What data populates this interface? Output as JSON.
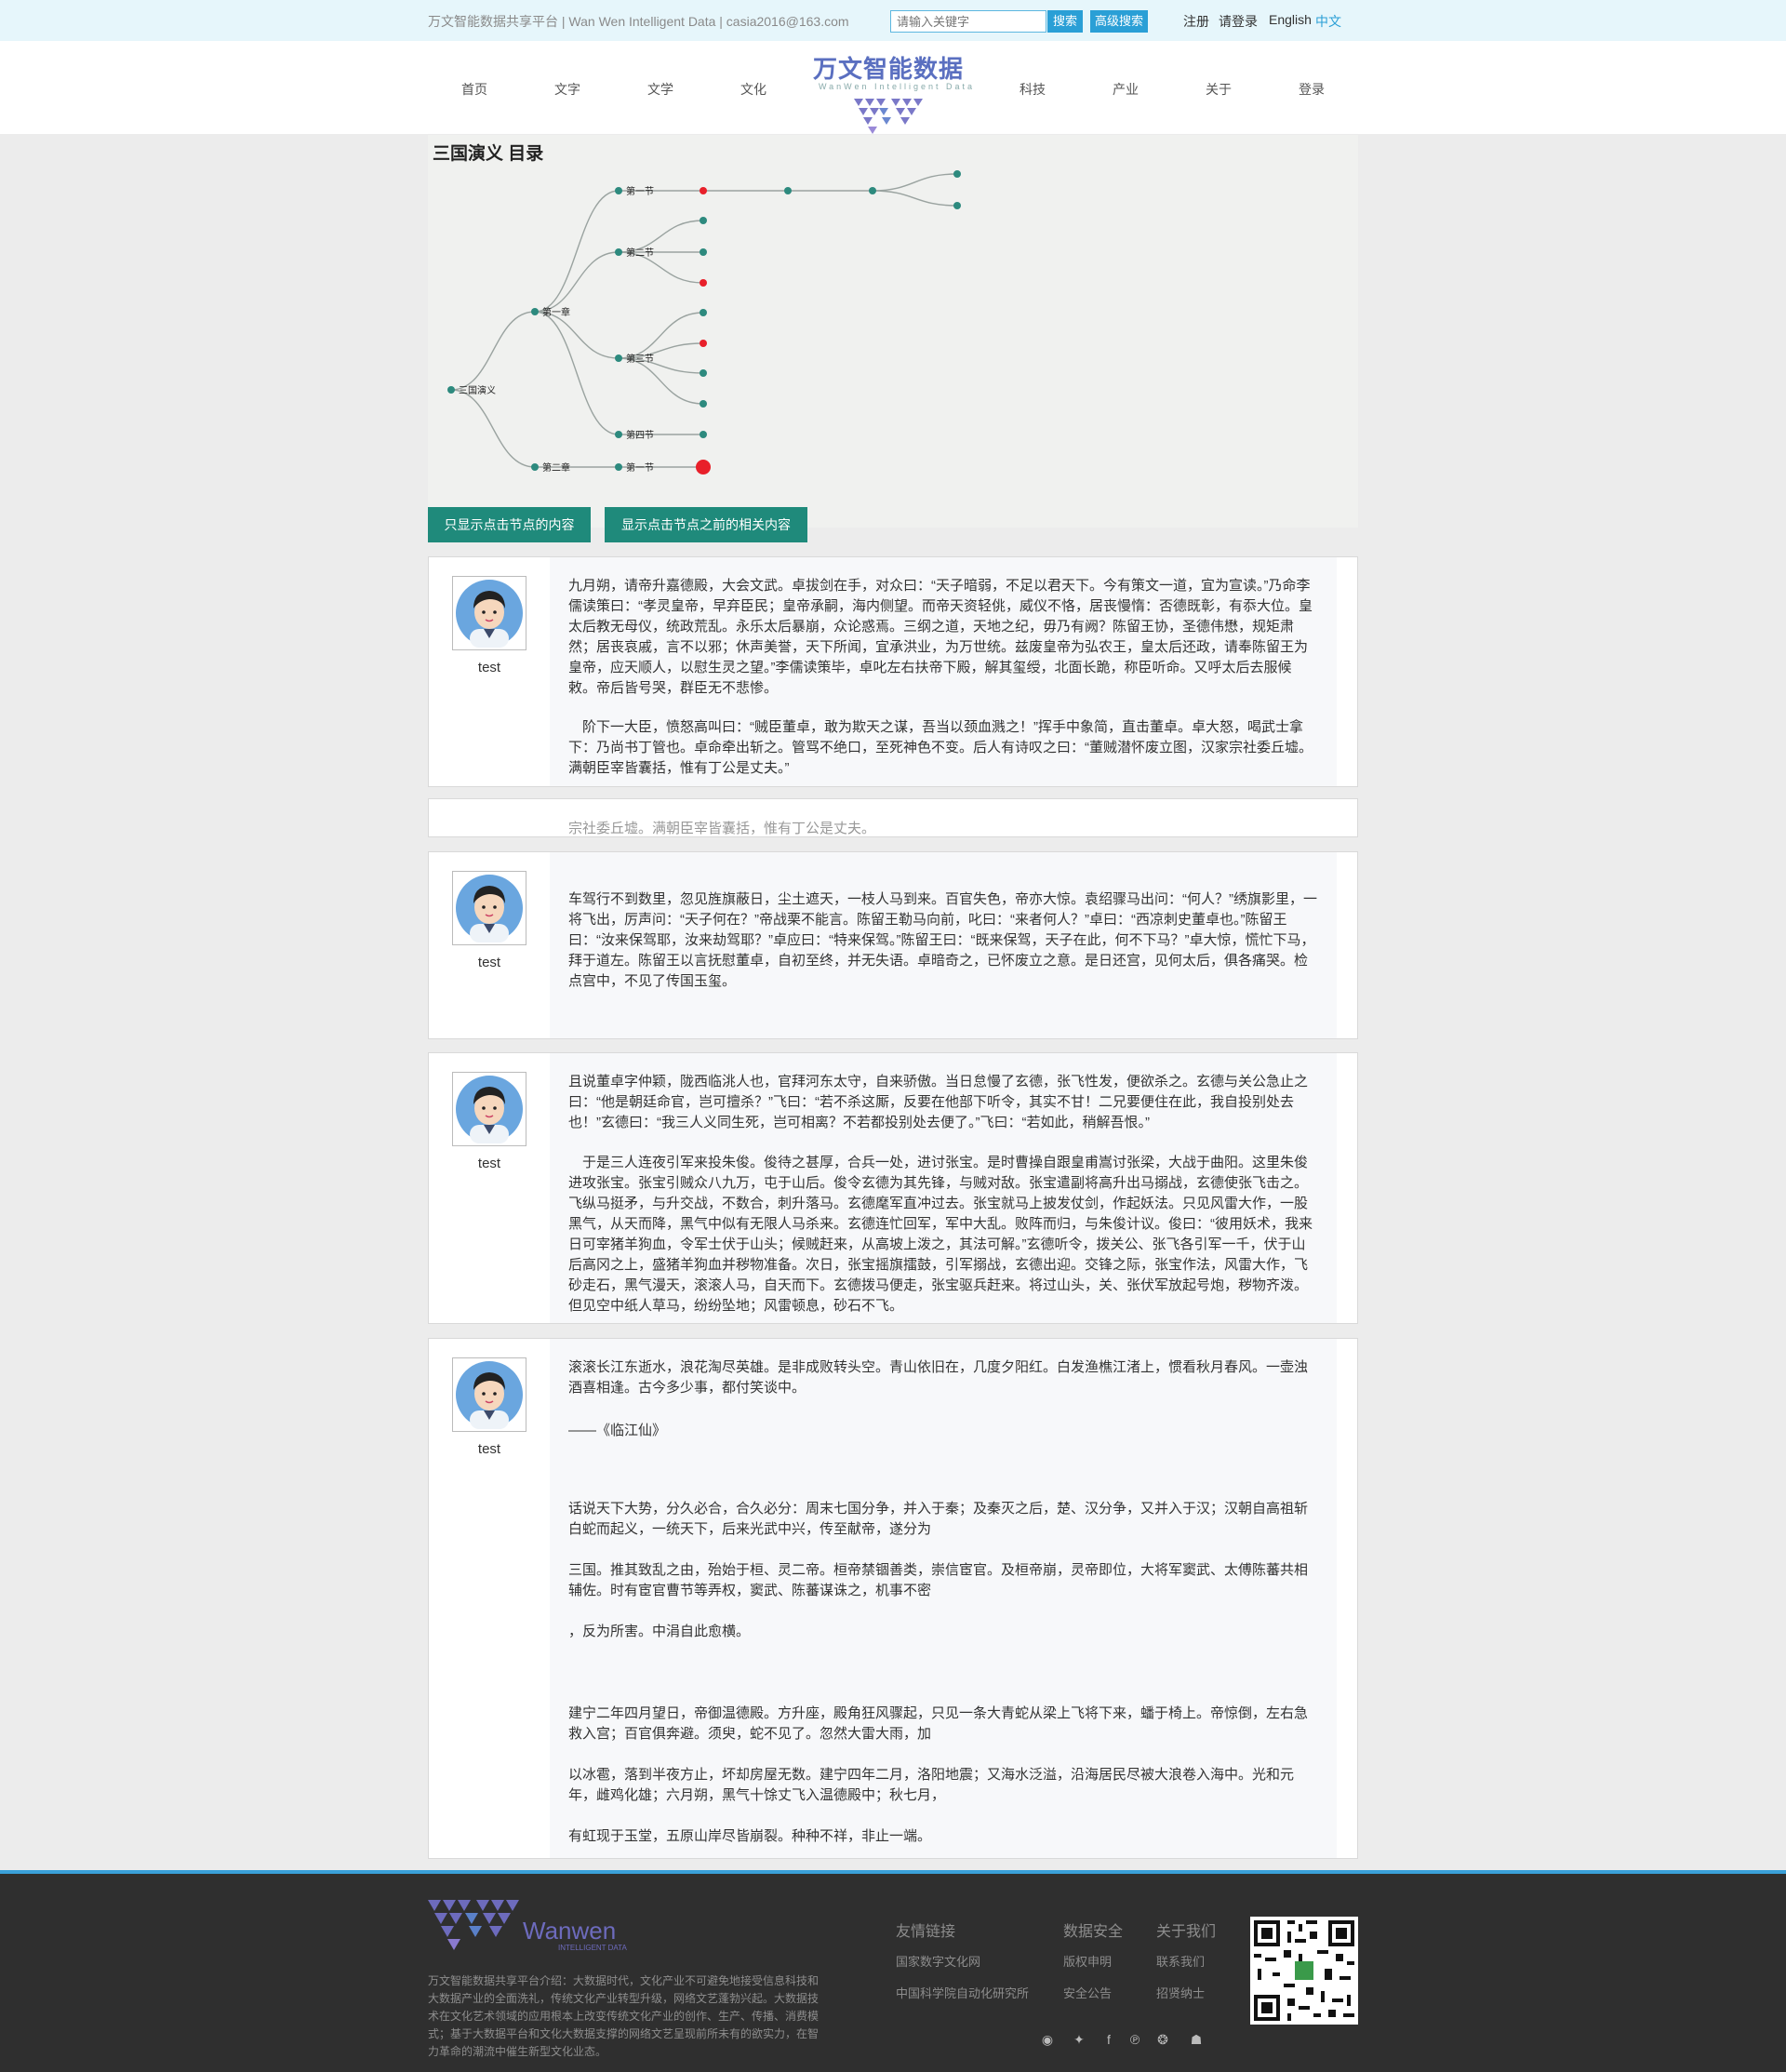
{
  "topbar": {
    "site_info": "万文智能数据共享平台 | Wan Wen Intelligent Data | casia2016@163.com",
    "search_placeholder": "请输入关键字",
    "search_label": "搜索",
    "advanced_label": "高级搜索",
    "register": "注册",
    "login": "请登录",
    "english": "English",
    "chinese": "中文"
  },
  "logo": {
    "title": "万文智能数据",
    "subtitle": "WanWen Intelligent Data"
  },
  "nav": [
    "首页",
    "文字",
    "文学",
    "文化",
    "科技",
    "产业",
    "关于",
    "登录"
  ],
  "page_title": "三国演义 目录",
  "tree": {
    "root": "三国演义",
    "chapter1": "第一章",
    "chapter2": "第二章",
    "s1": "第一节",
    "s2": "第二节",
    "s3": "第三节",
    "s4": "第四节",
    "c2s1": "第一节"
  },
  "buttons": {
    "only_clicked": "只显示点击节点的内容",
    "before_clicked": "显示点击节点之前的相关内容"
  },
  "posts": [
    {
      "author": "test",
      "paragraphs": [
        "九月朔，请帝升嘉德殿，大会文武。卓拔剑在手，对众曰：“天子暗弱，不足以君天下。今有策文一道，宜为宣读。”乃命李儒读策曰：“孝灵皇帝，早弃臣民；皇帝承嗣，海内侧望。而帝天资轻佻，威仪不恪，居丧慢惰：否德既彰，有忝大位。皇太后教无母仪，统政荒乱。永乐太后暴崩，众论惑焉。三纲之道，天地之纪，毋乃有阙？陈留王协，圣德伟懋，规矩肃然；居丧哀戚，言不以邪；休声美誉，天下所闻，宜承洪业，为万世统。兹废皇帝为弘农王，皇太后还政，请奉陈留王为皇帝，应天顺人，以慰生灵之望。”李儒读策毕，卓叱左右扶帝下殿，解其玺绶，北面长跪，称臣听命。又呼太后去服候敕。帝后皆号哭，群臣无不悲惨。",
        "　阶下一大臣，愤怒高叫曰：“贼臣董卓，敢为欺天之谋，吾当以颈血溅之！”挥手中象简，直击董卓。卓大怒，喝武士拿下：乃尚书丁管也。卓命牵出斩之。管骂不绝口，至死神色不变。后人有诗叹之曰：“董贼潜怀废立图，汉家宗社委丘墟。满朝臣宰皆囊括，惟有丁公是丈夫。”"
      ]
    },
    {
      "author": "test",
      "paragraphs": [
        "车驾行不到数里，忽见旌旗蔽日，尘土遮天，一枝人马到来。百官失色，帝亦大惊。袁绍骤马出问：“何人？”绣旗影里，一将飞出，厉声问：“天子何在？”帝战栗不能言。陈留王勒马向前，叱曰：“来者何人？”卓曰：“西凉刺史董卓也。”陈留王曰：“汝来保驾耶，汝来劫驾耶？”卓应曰：“特来保驾。”陈留王曰：“既来保驾，天子在此，何不下马？”卓大惊，慌忙下马，拜于道左。陈留王以言抚慰董卓，自初至终，并无失语。卓暗奇之，已怀废立之意。是日还宫，见何太后，俱各痛哭。检点宫中，不见了传国玉玺。"
      ]
    },
    {
      "author": "test",
      "paragraphs": [
        "且说董卓字仲颖，陇西临洮人也，官拜河东太守，自来骄傲。当日怠慢了玄德，张飞性发，便欲杀之。玄德与关公急止之曰：“他是朝廷命官，岂可擅杀？”飞曰：“若不杀这厮，反要在他部下听令，其实不甘！二兄要便住在此，我自投别处去也！”玄德曰：“我三人义同生死，岂可相离？不若都投别处去便了。”飞曰：“若如此，稍解吾恨。”",
        "　于是三人连夜引军来投朱俊。俊待之甚厚，合兵一处，进讨张宝。是时曹操自跟皇甫嵩讨张梁，大战于曲阳。这里朱俊进攻张宝。张宝引贼众八九万，屯于山后。俊令玄德为其先锋，与贼对敌。张宝遣副将高升出马搦战，玄德使张飞击之。飞纵马挺矛，与升交战，不数合，刺升落马。玄德麾军直冲过去。张宝就马上披发仗剑，作起妖法。只见风雷大作，一股黑气，从天而降，黑气中似有无限人马杀来。玄德连忙回军，军中大乱。败阵而归，与朱俊计议。俊曰：“彼用妖术，我来日可宰猪羊狗血，令军士伏于山头；候贼赶来，从高坡上泼之，其法可解。”玄德听令，拨关公、张飞各引军一千，伏于山后高冈之上，盛猪羊狗血并秽物准备。次日，张宝摇旗擂鼓，引军搦战，玄德出迎。交锋之际，张宝作法，风雷大作，飞砂走石，黑气漫天，滚滚人马，自天而下。玄德拨马便走，张宝驱兵赶来。将过山头，关、张伏军放起号炮，秽物齐泼。但见空中纸人草马，纷纷坠地；风雷顿息，砂石不飞。"
      ]
    },
    {
      "author": "test",
      "paragraphs": [
        "滚滚长江东逝水，浪花淘尽英雄。是非成败转头空。青山依旧在，几度夕阳红。白发渔樵江渚上，惯看秋月春风。一壶浊酒喜相逢。古今多少事，都付笑谈中。",
        "——《临江仙》",
        "话说天下大势，分久必合，合久必分：周末七国分争，并入于秦；及秦灭之后，楚、汉分争，又并入于汉；汉朝自高祖斩白蛇而起义，一统天下，后来光武中兴，传至献帝，遂分为",
        "三国。推其致乱之由，殆始于桓、灵二帝。桓帝禁锢善类，崇信宦官。及桓帝崩，灵帝即位，大将军窦武、太傅陈蕃共相辅佐。时有宦官曹节等弄权，窦武、陈蕃谋诛之，机事不密",
        "，反为所害。中涓自此愈横。",
        "建宁二年四月望日，帝御温德殿。方升座，殿角狂风骤起，只见一条大青蛇从梁上飞将下来，蟠于椅上。帝惊倒，左右急救入宫；百官俱奔避。须臾，蛇不见了。忽然大雷大雨，加",
        "以冰雹，落到半夜方止，坏却房屋无数。建宁四年二月，洛阳地震；又海水泛溢，沿海居民尽被大浪卷入海中。光和元年，雌鸡化雄；六月朔，黑气十馀丈飞入温德殿中；秋七月，",
        "有虹现于玉堂，五原山岸尽皆崩裂。种种不祥，非止一端。"
      ]
    }
  ],
  "ghost_text": "宗社委丘墟。满朝臣宰皆囊括，惟有丁公是丈夫。",
  "footer": {
    "brand": "Wanwen",
    "brand_sub": "INTELLIGENT DATA",
    "intro": "万文智能数据共享平台介绍：大数据时代，文化产业不可避免地接受信息科技和大数据产业的全面洗礼，传统文化产业转型升级，网络文艺蓬勃兴起。大数据技术在文化艺术领域的应用根本上改变传统文化产业的创作、生产、传播、消费模式；基于大数据平台和文化大数据支撑的网络文艺呈现前所未有的欲实力，在智力革命的潮流中催生新型文化业态。",
    "col1_head": "友情链接",
    "col1_links": [
      "国家数字文化网",
      "中国科学院自动化研究所"
    ],
    "col2_head": "数据安全",
    "col2_links": [
      "版权申明",
      "安全公告"
    ],
    "col3_head": "关于我们",
    "col3_links": [
      "联系我们",
      "招贤纳士"
    ],
    "social": [
      "wechat-icon",
      "twitter-icon",
      "facebook-icon",
      "pinterest-icon",
      "weibo-icon",
      "qq-icon"
    ]
  }
}
